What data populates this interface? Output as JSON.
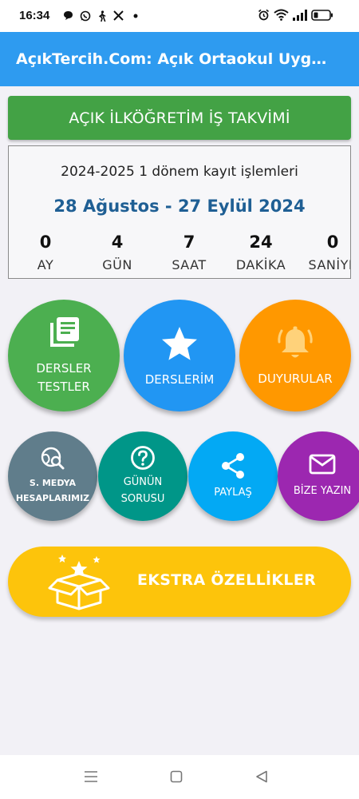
{
  "status_bar": {
    "time": "16:34",
    "notification_icons": [
      "chat-bubble-icon",
      "whatsapp-icon",
      "walking-person-icon",
      "x-twitter-icon",
      "dot-icon"
    ],
    "system_icons": [
      "alarm-icon",
      "wifi-icon",
      "signal-icon",
      "battery-icon"
    ]
  },
  "app_bar": {
    "title": "AçıkTercih.Com: Açık Ortaokul Uygulaması",
    "color": "#2e9bf0"
  },
  "calendar_button": {
    "label": "AÇIK İLKÖĞRETİM İŞ TAKVİMİ",
    "color": "#43a245"
  },
  "countdown": {
    "title": "2024-2025 1 dönem kayıt işlemleri",
    "dates": "28 Ağustos - 27 Eylül 2024",
    "units": [
      {
        "value": "0",
        "label": "AY"
      },
      {
        "value": "4",
        "label": "GÜN"
      },
      {
        "value": "7",
        "label": "SAAT"
      },
      {
        "value": "24",
        "label": "DAKİKA"
      },
      {
        "value": "0",
        "label": "SANİYE"
      }
    ]
  },
  "main_buttons": [
    {
      "line1": "DERSLER",
      "line2": "TESTLER",
      "icon": "book-pages-icon",
      "color": "#4caf50"
    },
    {
      "line1": "DERSLERİM",
      "icon": "star-icon",
      "color": "#2196f3"
    },
    {
      "line1": "DUYURULAR",
      "icon": "bell-ringing-icon",
      "color": "#ff9800"
    }
  ],
  "secondary_buttons": [
    {
      "line1": "S. MEDYA",
      "line2": "HESAPLARIMIZ",
      "icon": "globe-search-icon",
      "color": "#607d8b"
    },
    {
      "line1": "GÜNÜN",
      "line2": "SORUSU",
      "icon": "question-circle-icon",
      "color": "#009688"
    },
    {
      "line1": "PAYLAŞ",
      "icon": "share-icon",
      "color": "#03a9f4"
    },
    {
      "line1": "BİZE YAZIN",
      "icon": "mail-icon",
      "color": "#9c27b0"
    }
  ],
  "extra_button": {
    "label": "EKSTRA ÖZELLİKLER",
    "icon": "gift-box-stars-icon",
    "color": "#fdc40b"
  },
  "nav_bar": {
    "icons": [
      "recent-apps-icon",
      "home-icon",
      "back-icon"
    ]
  }
}
